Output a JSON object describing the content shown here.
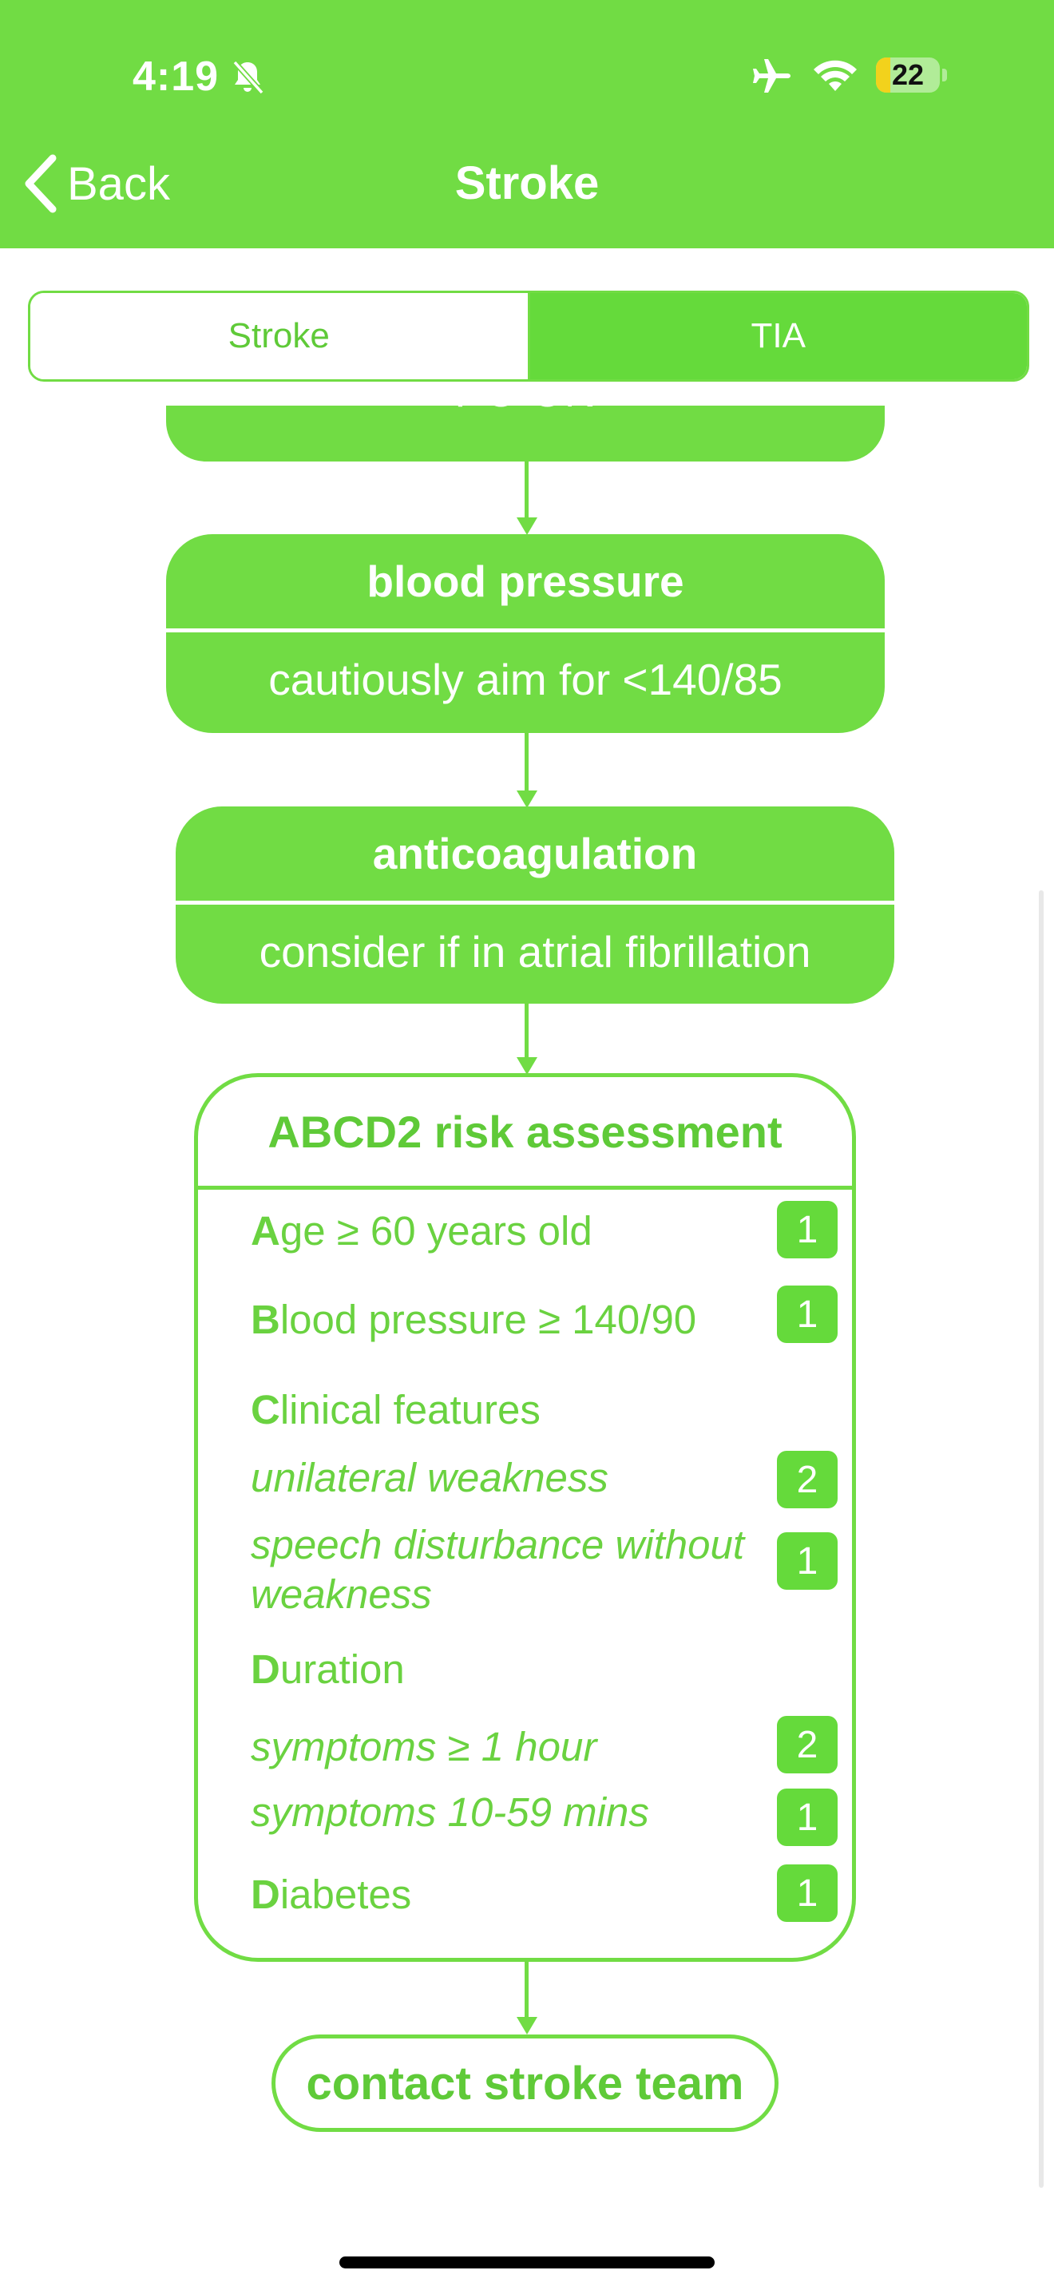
{
  "status_bar": {
    "time": "4:19",
    "battery": "22",
    "battery_level": 0.22,
    "icons": [
      "bell-slash-icon",
      "airplane-icon",
      "wifi-icon",
      "battery-icon"
    ]
  },
  "nav": {
    "back_label": "Back",
    "title": "Stroke"
  },
  "segments": {
    "stroke": "Stroke",
    "tia": "TIA",
    "selected": "TIA"
  },
  "flow": {
    "top_box": "PO ON",
    "blood_pressure": {
      "title": "blood pressure",
      "body": "cautiously aim for <140/85"
    },
    "anticoagulation": {
      "title": "anticoagulation",
      "body": "consider if in atrial fibrillation"
    },
    "abcd2": {
      "title": "ABCD2 risk assessment",
      "age": {
        "letter": "A",
        "rest": "ge ≥ 60 years old",
        "score": "1"
      },
      "bp": {
        "letter": "B",
        "rest": "lood pressure ≥ 140/90",
        "score": "1"
      },
      "clinical": {
        "letter": "C",
        "rest": "linical features"
      },
      "unilateral": {
        "text": "unilateral weakness",
        "score": "2"
      },
      "speech": {
        "text": "speech disturbance without weakness",
        "score": "1"
      },
      "duration": {
        "letter": "D",
        "rest": "uration"
      },
      "hour": {
        "text": "symptoms ≥ 1 hour",
        "score": "2"
      },
      "mins": {
        "text": "symptoms 10-59 mins",
        "score": "1"
      },
      "diabetes": {
        "letter": "D",
        "rest": "iabetes",
        "score": "1"
      }
    },
    "contact": "contact stroke team"
  },
  "colors": {
    "brand_green": "#71dc44",
    "segment_selected": "#65da3b",
    "text_green": "#5fca38"
  }
}
